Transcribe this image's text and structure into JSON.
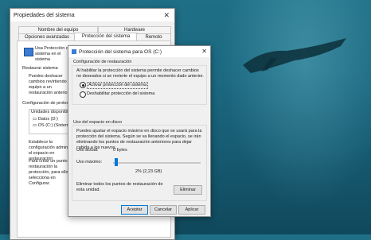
{
  "back_window": {
    "title": "Propiedades del sistema",
    "tabs_row1": [
      "Nombre del equipo",
      "Hardware"
    ],
    "tabs_row2": [
      "Opciones avanzadas",
      "Protección del sistema",
      "Remoto"
    ],
    "intro": "Usa Protección del sistema en el sistema",
    "restore_heading": "Restaurar sistema",
    "restore_text": "Puedes deshacer cambios revirtiendo el equipo a un restauración anterior.",
    "config_heading": "Configuración de protección",
    "drives_header": "Unidades disponibles",
    "drives": [
      "Datos (D:)",
      "OS (C:) (Sistema)"
    ],
    "config_text": "Establece la configuración administra el espacio en restauración",
    "create_text": "Para crear un punto de restauración la protección, para ello se selecciona en Configurar."
  },
  "dialog": {
    "title": "Protección del sistema para OS (C:)",
    "restore_section": "Configuración de restauración",
    "restore_desc": "Al habilitar la protección del sistema permite deshacer cambios no deseados si se revierte el equipo a un momento dado anterior.",
    "options": [
      "Activar protección del sistema",
      "Deshabilitar protección del sistema"
    ],
    "selected_option": 0,
    "disk_section": "Uso del espacio en disco",
    "disk_desc": "Puedes ajustar el espacio máximo en disco que se usará para la protección del sistema. Según se va llenando el espacio, se irán eliminando los puntos de restauración anteriores para dejar cabida a los nuevos.",
    "current_label": "Uso actual:",
    "current_value": "0 bytes",
    "max_label": "Uso máximo:",
    "max_value": "2% (2,23 GB)",
    "max_fraction": 0.02,
    "delete_text": "Eliminar todos los puntos de restauración de esta unidad.",
    "delete_button": "Eliminar",
    "buttons": {
      "ok": "Aceptar",
      "cancel": "Cancelar",
      "apply": "Aplicar"
    }
  }
}
